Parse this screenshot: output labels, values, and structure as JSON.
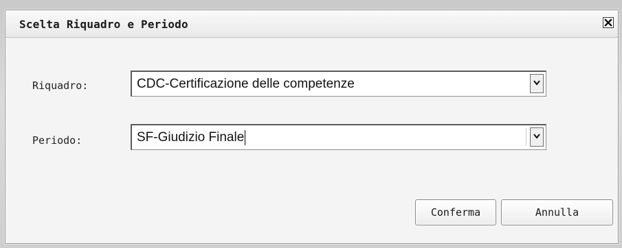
{
  "dialog": {
    "title": "Scelta Riquadro e Periodo",
    "close_icon": "close-icon"
  },
  "fields": {
    "riquadro": {
      "label": "Riquadro:",
      "value": "CDC-Certificazione delle competenze"
    },
    "periodo": {
      "label": "Periodo:",
      "value": "SF-Giudizio Finale"
    }
  },
  "buttons": {
    "confirm": "Conferma",
    "cancel": "Annulla"
  }
}
